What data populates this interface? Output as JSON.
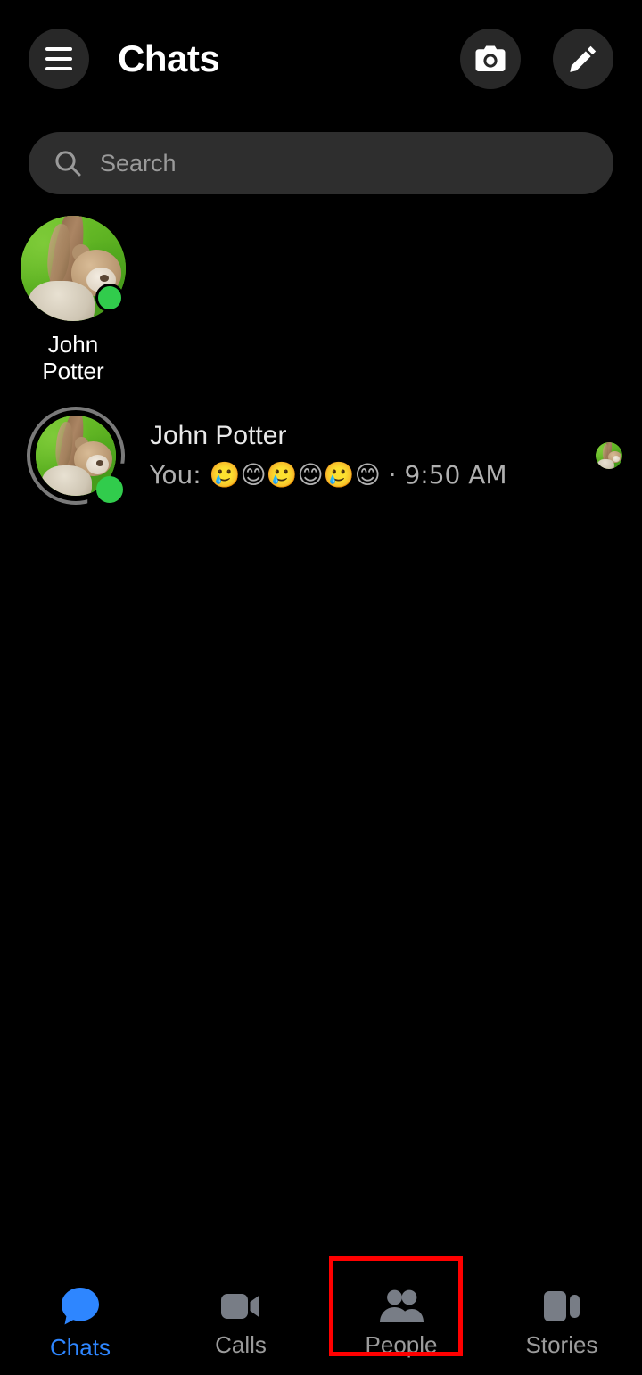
{
  "app": {
    "background_color": "#000000",
    "accent_color": "#2e86ff",
    "highlight_color": "#ff0000",
    "online_color": "#31cc4c"
  },
  "header": {
    "title": "Chats",
    "menu_icon": "hamburger-menu-icon",
    "camera_icon": "camera-icon",
    "compose_icon": "pencil-compose-icon"
  },
  "search": {
    "placeholder": "Search",
    "icon": "search-icon"
  },
  "stories": [
    {
      "name": "John Potter",
      "online": true,
      "avatar_alt": "teddy-bear-on-green-background"
    }
  ],
  "chats": [
    {
      "name": "John Potter",
      "preview": "You: 🥲😊🥲😊🥲😊 · 9:50 AM",
      "preview_prefix": "You:",
      "preview_emojis": "🥲😊🥲😊🥲😊",
      "separator": "·",
      "time": "9:50 AM",
      "online": true,
      "has_story_ring": true,
      "read_receipt": true,
      "avatar_alt": "teddy-bear-on-green-background"
    }
  ],
  "bottom_nav": {
    "items": [
      {
        "label": "Chats",
        "icon": "chat-bubble-icon",
        "active": true,
        "highlighted": false
      },
      {
        "label": "Calls",
        "icon": "video-camera-icon",
        "active": false,
        "highlighted": false
      },
      {
        "label": "People",
        "icon": "people-icon",
        "active": false,
        "highlighted": true
      },
      {
        "label": "Stories",
        "icon": "stories-icon",
        "active": false,
        "highlighted": false
      }
    ]
  }
}
